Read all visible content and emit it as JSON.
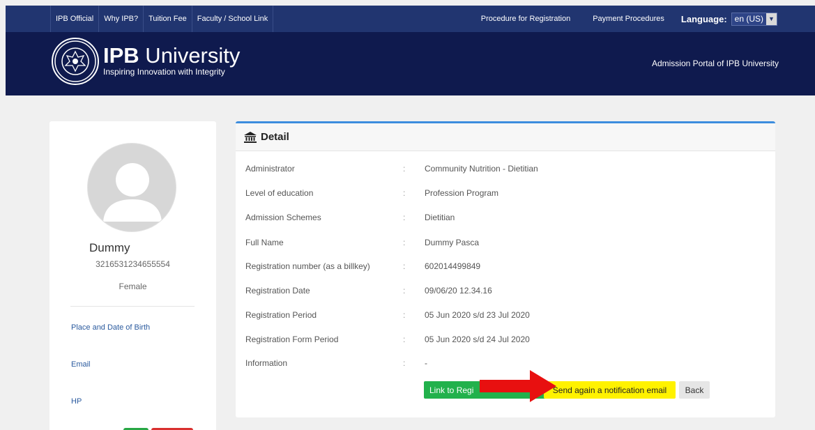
{
  "topbar": {
    "left_links": [
      "IPB Official",
      "Why IPB?",
      "Tuition Fee",
      "Faculty / School Link"
    ],
    "right_links": [
      "Procedure for Registration",
      "Payment Procedures"
    ],
    "language_label": "Language:",
    "language_value": "en (US)"
  },
  "header": {
    "brand_bold": "IPB",
    "brand_rest": " University",
    "tagline": "Inspiring Innovation with Integrity",
    "portal": "Admission Portal of IPB University"
  },
  "profile": {
    "name": "Dummy",
    "id": "3216531234655554",
    "gender": "Female",
    "fields": [
      "Place and Date of Birth",
      "Email",
      "HP"
    ]
  },
  "detail": {
    "title": "Detail",
    "rows": [
      {
        "label": "Administrator",
        "sep": ":",
        "value": "Community Nutrition - Dietitian"
      },
      {
        "label": "Level of education",
        "sep": ":",
        "value": "Profession Program"
      },
      {
        "label": "Admission Schemes",
        "sep": ":",
        "value": "Dietitian"
      },
      {
        "label": "Full Name",
        "sep": ":",
        "value": "Dummy Pasca"
      },
      {
        "label": "Registration number (as a billkey)",
        "sep": ":",
        "value": "602014499849"
      },
      {
        "label": "Registration Date",
        "sep": ":",
        "value": "09/06/20 12.34.16"
      },
      {
        "label": "Registration Period",
        "sep": ":",
        "value": "05 Jun 2020 s/d 23 Jul 2020"
      },
      {
        "label": "Registration Form Period",
        "sep": ":",
        "value": "05 Jun 2020 s/d 24 Jul 2020"
      },
      {
        "label": "Information",
        "sep": ":",
        "value": "-"
      }
    ],
    "btn_link": "Link to Regi",
    "btn_send": "Send again a notification email",
    "btn_back": "Back"
  },
  "colors": {
    "topbar": "#213570",
    "header": "#0f1a4e",
    "accent_blue": "#3c8dde",
    "green": "#22b14c",
    "yellow": "#fff200",
    "arrow_red": "#e81010"
  }
}
